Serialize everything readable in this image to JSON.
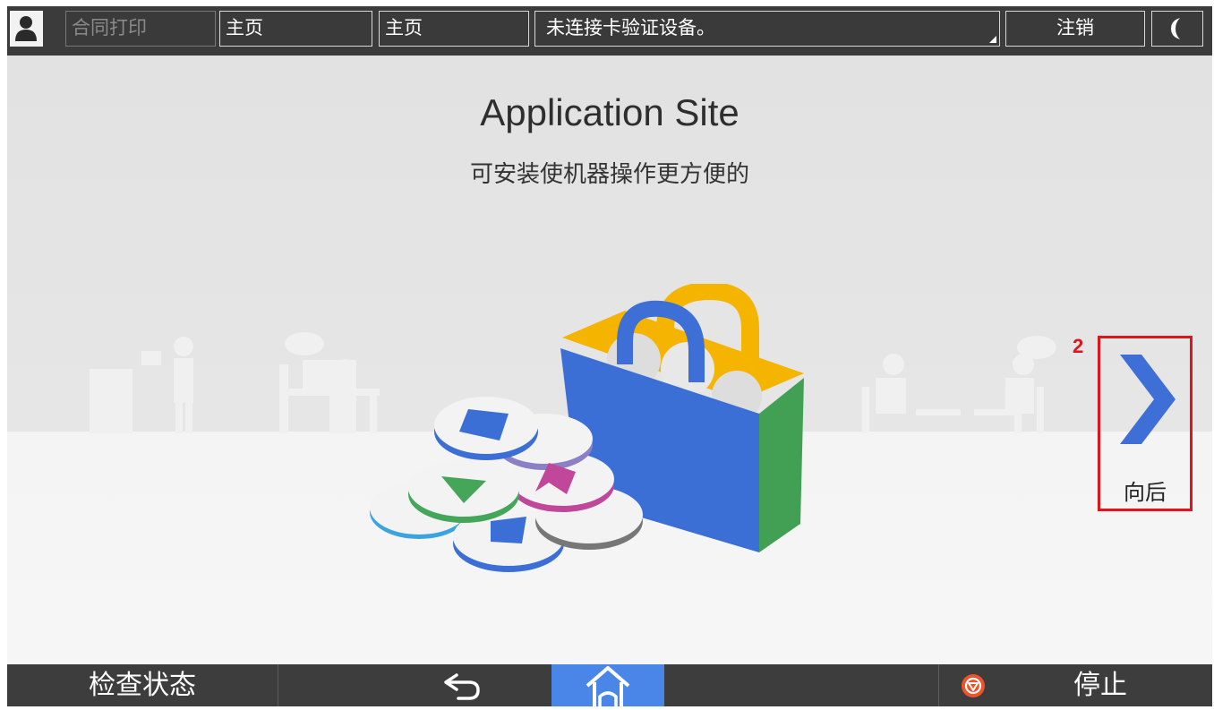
{
  "topbar": {
    "user_icon": "user-icon",
    "job_label": "合同打印",
    "home_label_1": "主页",
    "home_label_2": "主页",
    "message": "未连接卡验证设备。",
    "logout_label": "注销",
    "sleep_icon": "moon-icon"
  },
  "main": {
    "title": "Application Site",
    "subtitle": "可安装使机器操作更方便的",
    "next_label": "向后",
    "annotation_number": "2"
  },
  "bottombar": {
    "check_status_label": "检查状态",
    "back_icon": "back-arrow-icon",
    "home_icon": "home-icon",
    "stop_icon": "stop-icon",
    "stop_label": "停止"
  },
  "colors": {
    "accent_blue": "#4a86e8",
    "highlight_red": "#e0141c",
    "bar_dark": "#3b3b3b"
  }
}
